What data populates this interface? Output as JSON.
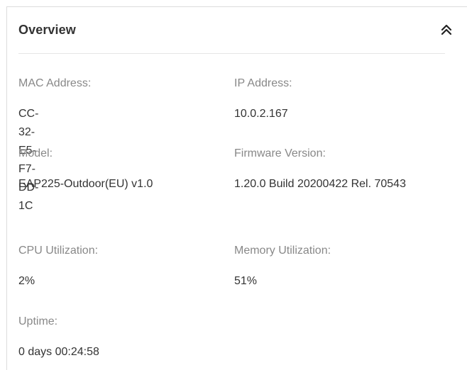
{
  "panel": {
    "title": "Overview",
    "collapse_icon": "double-chevron-up-icon",
    "text_color": "#333333",
    "label_color": "#888888"
  },
  "fields": {
    "mac_address": {
      "label": "MAC Address:",
      "value": "CC-32-E5-F7-DD-1C"
    },
    "ip_address": {
      "label": "IP Address:",
      "value": "10.0.2.167"
    },
    "model": {
      "label": "Model:",
      "value": "EAP225-Outdoor(EU) v1.0"
    },
    "firmware_version": {
      "label": "Firmware Version:",
      "value": "1.20.0 Build 20200422 Rel. 70543"
    },
    "cpu_utilization": {
      "label": "CPU Utilization:",
      "value": "2%"
    },
    "memory_utilization": {
      "label": "Memory Utilization:",
      "value": "51%"
    },
    "uptime": {
      "label": "Uptime:",
      "value": "0 days 00:24:58"
    }
  }
}
